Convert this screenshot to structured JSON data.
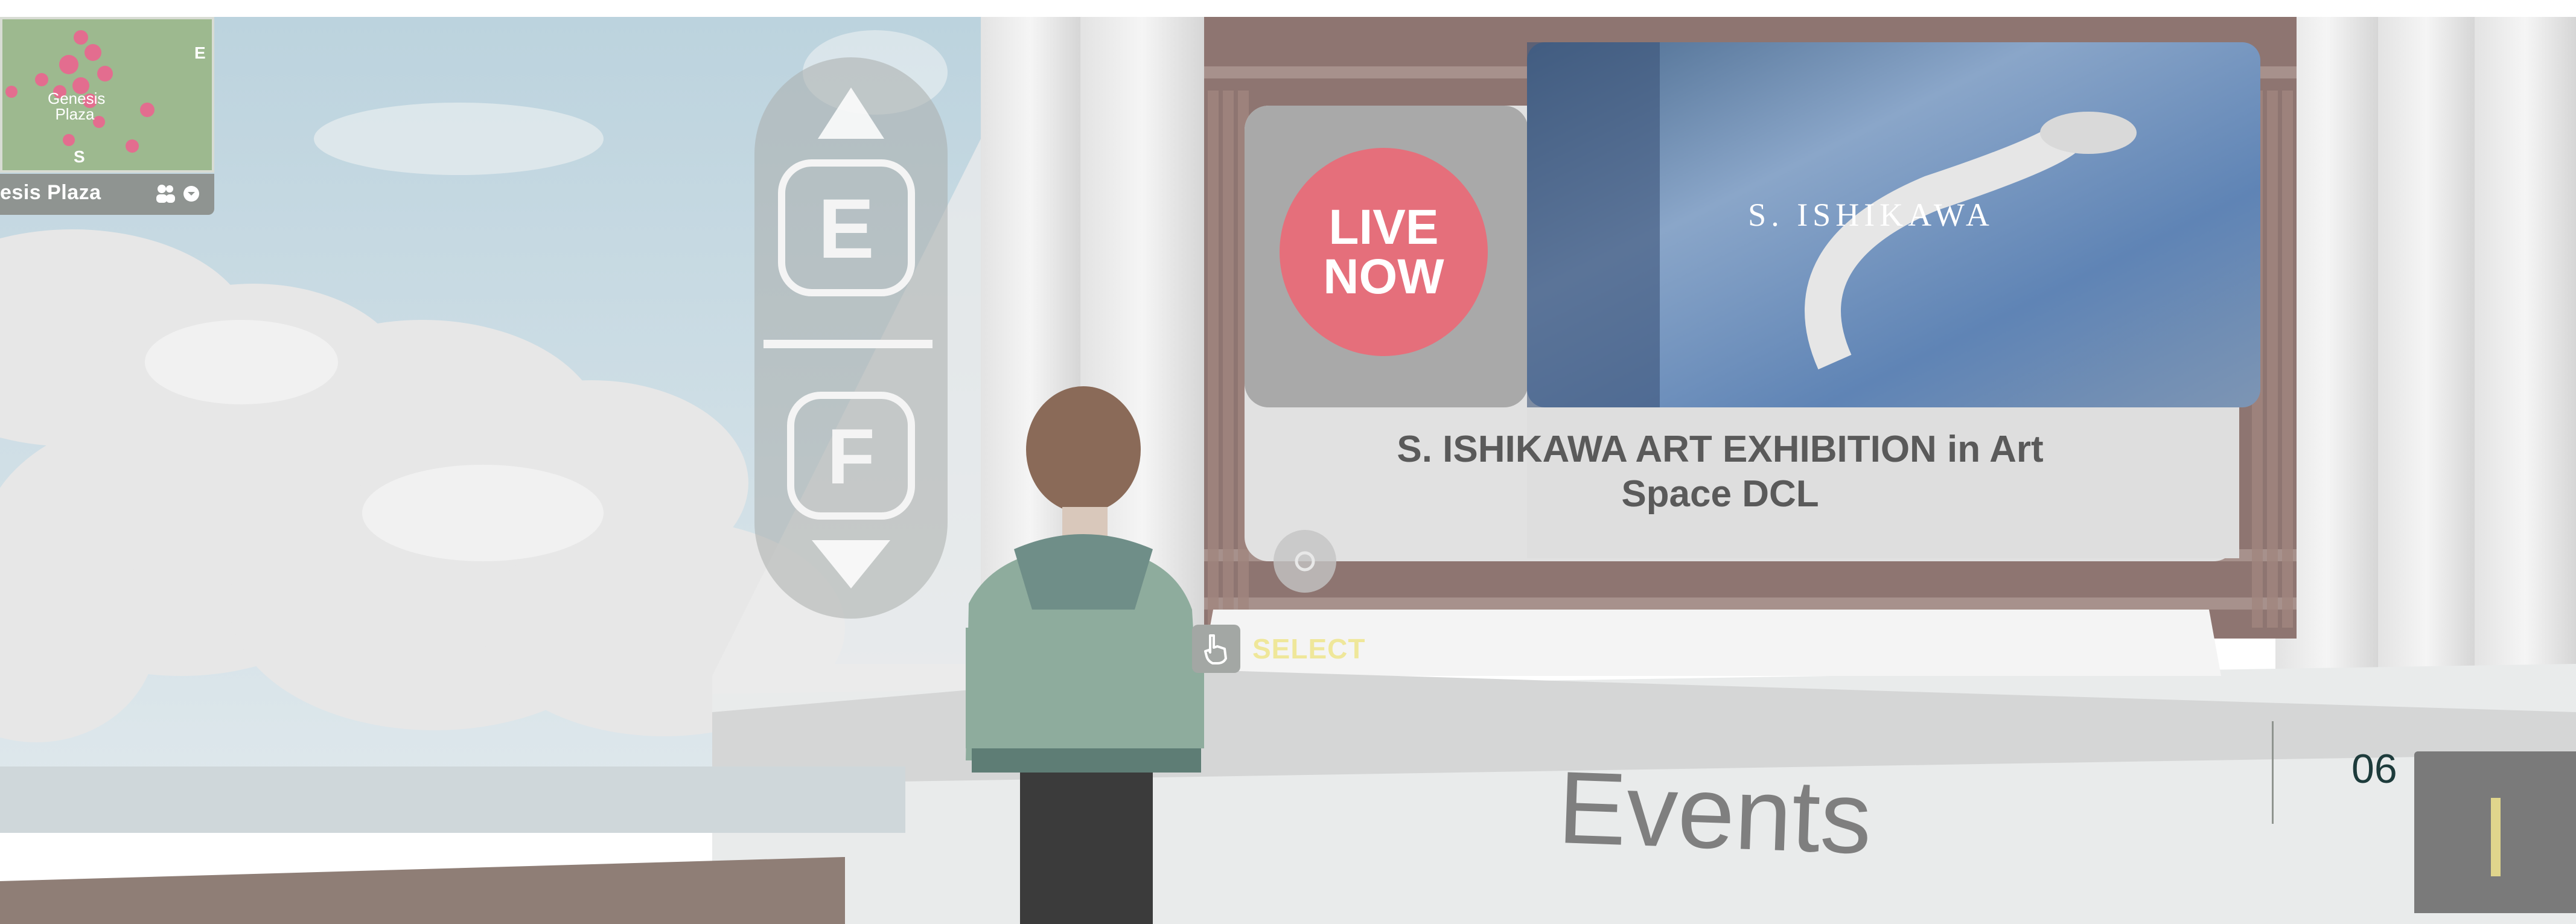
{
  "minimap": {
    "map_label": "Genesis Plaza",
    "compass_n": "E",
    "compass_s": "S",
    "place_name": "esis Plaza",
    "people_icon": "people-icon",
    "dropdown_icon": "chevron-down-icon"
  },
  "interaction_pill": {
    "up_icon": "arrow-up-icon",
    "key_e": "E",
    "key_f": "F",
    "down_icon": "arrow-down-icon"
  },
  "event_board": {
    "live_line1": "LIVE",
    "live_line2": "NOW",
    "poster_caption": "S. ISHIKAWA",
    "title_line1": "S. ISHIKAWA ART EXHIBITION in Art",
    "title_line2": "Space DCL"
  },
  "select_hint": {
    "icon": "hand-pointer-icon",
    "label": "SELECT"
  },
  "events_sign": "Events",
  "slide": {
    "number": "06"
  },
  "colors": {
    "sky": "#c9dbe3",
    "live_badge": "#e56f7b",
    "select_label": "#efe79a",
    "slide_number": "#1d3b3b",
    "corner_accent": "#e0d58c"
  }
}
